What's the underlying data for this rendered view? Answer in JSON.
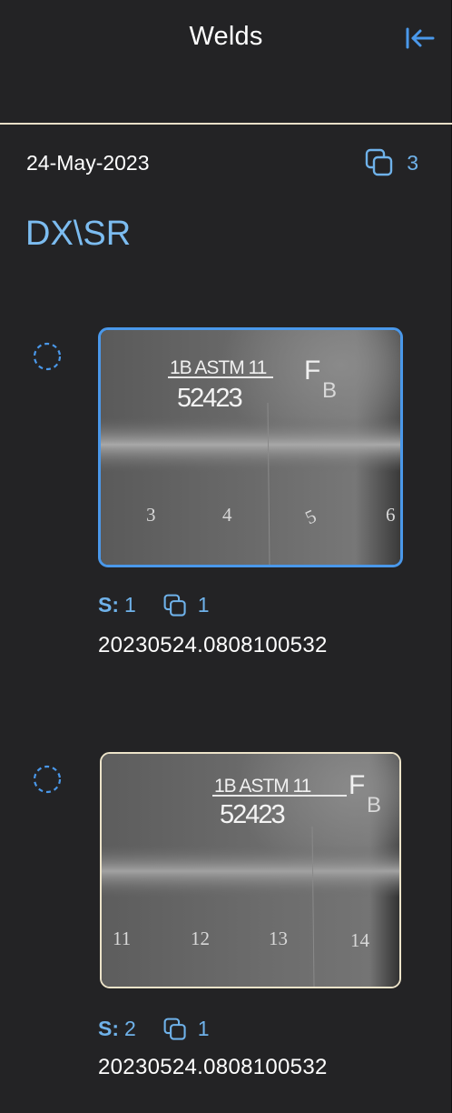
{
  "header": {
    "title": "Welds",
    "collapse_icon": "collapse-left-icon"
  },
  "group": {
    "date": "24-May-2023",
    "count": "3",
    "count_icon": "copies-icon",
    "title": "DX\\SR"
  },
  "items": [
    {
      "s_label": "S:",
      "series": "1",
      "copies": "1",
      "id": "20230524.0808100532",
      "selected": true,
      "image_text": {
        "line1": "1B ASTM 11",
        "line1b": "F",
        "line2": "52423",
        "line2b": "B",
        "markers": [
          "3",
          "4",
          "5",
          "6"
        ]
      }
    },
    {
      "s_label": "S:",
      "series": "2",
      "copies": "1",
      "id": "20230524.0808100532",
      "selected": false,
      "image_text": {
        "line1": "1B ASTM 11",
        "line1b": "F",
        "line2": "52423",
        "line2b": "B",
        "markers": [
          "11",
          "12",
          "13",
          "14"
        ]
      }
    }
  ],
  "colors": {
    "background": "#232325",
    "accent": "#4a98ea",
    "accent_text": "#6fb2ea",
    "divider": "#e8dfc8"
  }
}
